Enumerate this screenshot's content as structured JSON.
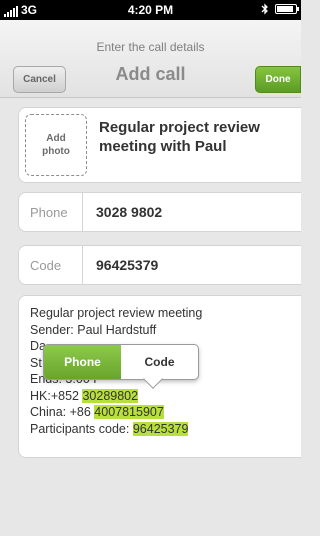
{
  "status_bar": {
    "carrier": "3G",
    "time": "4:20 PM",
    "bluetooth_icon": "bluetooth-icon",
    "battery_level": 0.8
  },
  "header": {
    "subtitle": "Enter the call details",
    "title": "Add call",
    "cancel_label": "Cancel",
    "done_label": "Done",
    "accent": "#6fae32"
  },
  "meeting": {
    "add_photo_line1": "Add",
    "add_photo_line2": "photo",
    "title": "Regular project review meeting with Paul"
  },
  "fields": {
    "phone_label": "Phone",
    "phone_value": "3028 9802",
    "code_label": "Code",
    "code_value": "96425379"
  },
  "note": {
    "line1": "Regular project review meeting",
    "line2": "Sender: Paul Hardstuff",
    "line3": "Da",
    "line4": "St",
    "line5_prefix": "Ends: 3:00 P",
    "line6_prefix": "HK:+852 ",
    "line6_hl": "30289802",
    "line7_prefix": "China: +86 ",
    "line7_hl": "4007815907",
    "line8_prefix": "Participants code: ",
    "line8_hl": "96425379"
  },
  "popover": {
    "phone_label": "Phone",
    "code_label": "Code",
    "selected": "Phone"
  }
}
